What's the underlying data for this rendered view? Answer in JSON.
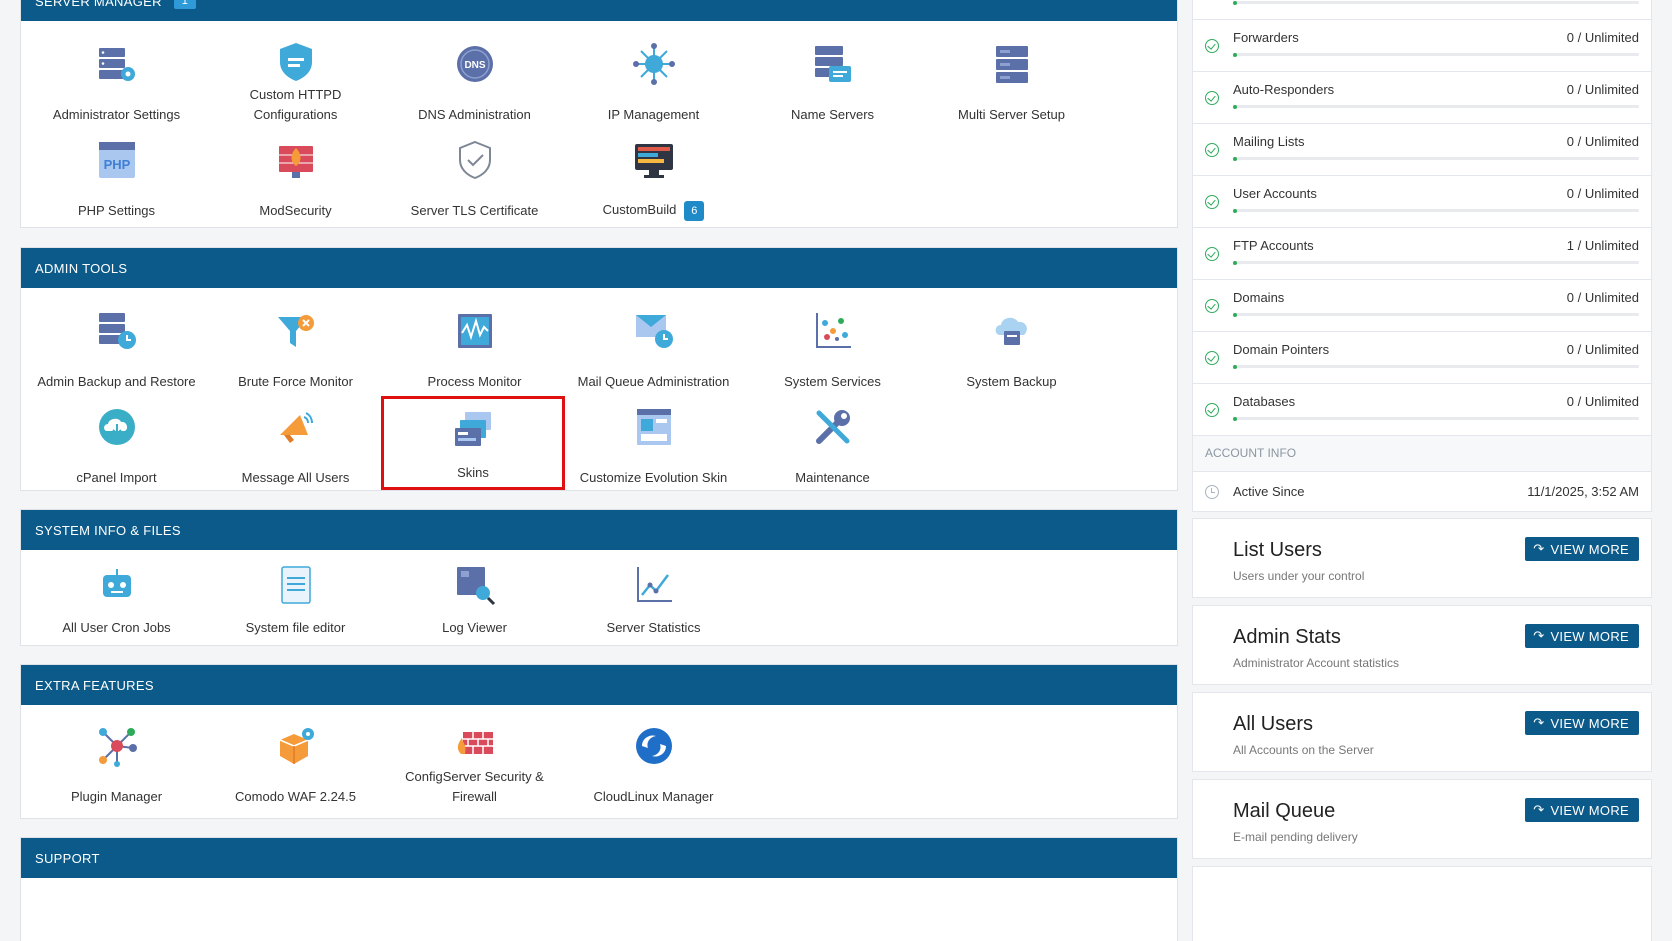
{
  "server_manager": {
    "header": "SERVER MANAGER",
    "badge": "1",
    "items": [
      {
        "label": "Administrator Settings"
      },
      {
        "label": "Custom HTTPD Configurations"
      },
      {
        "label": "DNS Administration"
      },
      {
        "label": "IP Management"
      },
      {
        "label": "Name Servers"
      },
      {
        "label": "Multi Server Setup"
      },
      {
        "label": "PHP Settings"
      },
      {
        "label": "ModSecurity"
      },
      {
        "label": "Server TLS Certificate"
      },
      {
        "label": "CustomBuild",
        "badge": "6"
      }
    ]
  },
  "admin_tools": {
    "header": "ADMIN TOOLS",
    "items": [
      {
        "label": "Admin Backup and Restore"
      },
      {
        "label": "Brute Force Monitor"
      },
      {
        "label": "Process Monitor"
      },
      {
        "label": "Mail Queue Administration"
      },
      {
        "label": "System Services"
      },
      {
        "label": "System Backup"
      },
      {
        "label": "cPanel Import"
      },
      {
        "label": "Message All Users"
      },
      {
        "label": "Skins"
      },
      {
        "label": "Customize Evolution Skin"
      },
      {
        "label": "Maintenance"
      }
    ]
  },
  "system_info": {
    "header": "SYSTEM INFO & FILES",
    "items": [
      {
        "label": "All User Cron Jobs"
      },
      {
        "label": "System file editor"
      },
      {
        "label": "Log Viewer"
      },
      {
        "label": "Server Statistics"
      }
    ]
  },
  "extra_features": {
    "header": "EXTRA FEATURES",
    "items": [
      {
        "label": "Plugin Manager"
      },
      {
        "label": "Comodo WAF 2.24.5"
      },
      {
        "label": "ConfigServer Security & Firewall"
      },
      {
        "label": "CloudLinux Manager"
      }
    ]
  },
  "support": {
    "header": "SUPPORT"
  },
  "usage": [
    {
      "name": "Forwarders",
      "value": "0 / Unlimited"
    },
    {
      "name": "Auto-Responders",
      "value": "0 / Unlimited"
    },
    {
      "name": "Mailing Lists",
      "value": "0 / Unlimited"
    },
    {
      "name": "User Accounts",
      "value": "0 / Unlimited"
    },
    {
      "name": "FTP Accounts",
      "value": "1 / Unlimited"
    },
    {
      "name": "Domains",
      "value": "0 / Unlimited"
    },
    {
      "name": "Domain Pointers",
      "value": "0 / Unlimited"
    },
    {
      "name": "Databases",
      "value": "0 / Unlimited"
    }
  ],
  "account_info": {
    "header": "ACCOUNT INFO",
    "active_since_label": "Active Since",
    "active_since_value": "11/1/2025, 3:52 AM"
  },
  "cards": [
    {
      "title": "List Users",
      "subtitle": "Users under your control",
      "button": "VIEW MORE"
    },
    {
      "title": "Admin Stats",
      "subtitle": "Administrator Account statistics",
      "button": "VIEW MORE"
    },
    {
      "title": "All Users",
      "subtitle": "All Accounts on the Server",
      "button": "VIEW MORE"
    },
    {
      "title": "Mail Queue",
      "subtitle": "E-mail pending delivery",
      "button": "VIEW MORE"
    }
  ],
  "colors": {
    "header_bg": "#0c5a8a",
    "accent": "#1f8ac8",
    "success": "#2eab5a",
    "highlight": "#e01010"
  }
}
